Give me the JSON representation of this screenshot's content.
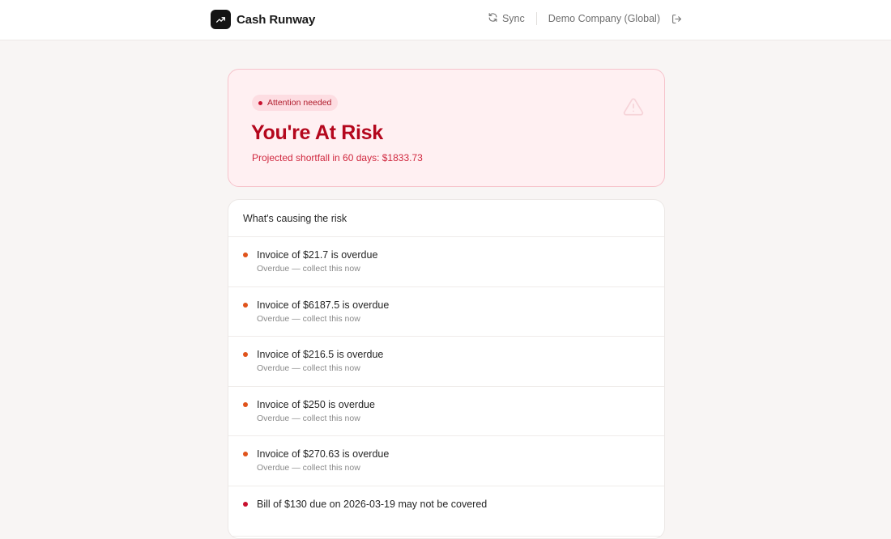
{
  "header": {
    "brand_name": "Cash Runway",
    "sync_label": "Sync",
    "company_label": "Demo Company (Global)"
  },
  "risk": {
    "badge": "Attention needed",
    "title": "You're At Risk",
    "subtitle": "Projected shortfall in 60 days: $1833.73"
  },
  "causes": {
    "header": "What's causing the risk",
    "items": [
      {
        "title": "Invoice of $21.7 is overdue",
        "subtitle": "Overdue — collect this now",
        "color": "#e0531b"
      },
      {
        "title": "Invoice of $6187.5 is overdue",
        "subtitle": "Overdue — collect this now",
        "color": "#e0531b"
      },
      {
        "title": "Invoice of $216.5 is overdue",
        "subtitle": "Overdue — collect this now",
        "color": "#e0531b"
      },
      {
        "title": "Invoice of $250 is overdue",
        "subtitle": "Overdue — collect this now",
        "color": "#e0531b"
      },
      {
        "title": "Invoice of $270.63 is overdue",
        "subtitle": "Overdue — collect this now",
        "color": "#e0531b"
      },
      {
        "title": "Bill of $130 due on 2026-03-19 may not be covered",
        "subtitle": "",
        "color": "#c8102e"
      }
    ]
  },
  "colors": {
    "accent_red": "#b4071d",
    "overdue_orange": "#e0531b",
    "bill_red": "#c8102e"
  },
  "icons": {
    "brand": "trending-up-icon",
    "sync": "refresh-icon",
    "logout": "logout-icon",
    "warning": "warning-triangle-icon"
  }
}
